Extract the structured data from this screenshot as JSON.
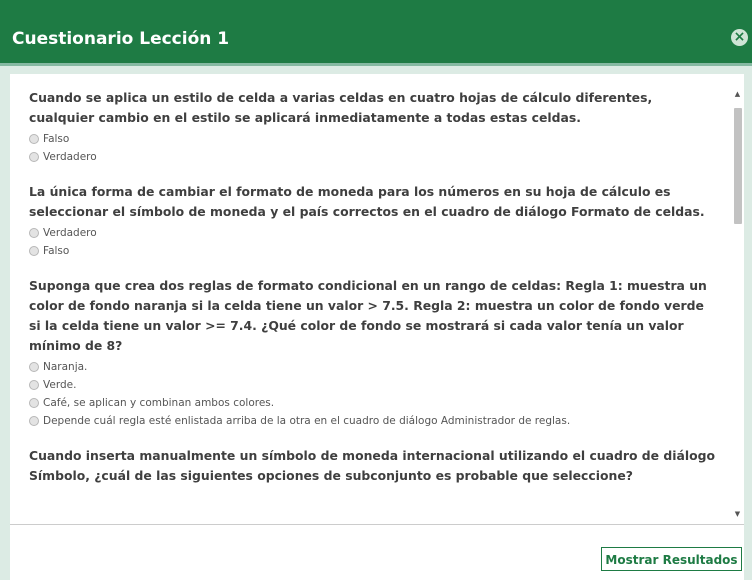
{
  "window": {
    "title": "Cuestionario Lección 1",
    "close_symbol": "×"
  },
  "questions": [
    {
      "text": "Cuando se aplica un estilo de celda a varias celdas en cuatro hojas de cálculo diferentes, cualquier cambio en el estilo se aplicará inmediatamente a todas estas celdas.",
      "options": [
        "Falso",
        "Verdadero"
      ]
    },
    {
      "text": "La única forma de cambiar el formato de moneda para los números en su hoja de cálculo es seleccionar el símbolo de moneda y el país correctos en el cuadro de diálogo Formato de celdas.",
      "options": [
        "Verdadero",
        "Falso"
      ]
    },
    {
      "text": "Suponga que crea dos reglas de formato condicional en un rango de celdas: Regla 1: muestra un color de fondo naranja si la celda tiene un valor > 7.5. Regla 2: muestra un color de fondo verde si la celda tiene un valor >= 7.4. ¿Qué color de fondo se mostrará si cada valor tenía un valor mínimo de 8?",
      "options": [
        "Naranja.",
        "Verde.",
        "Café, se aplican y combinan ambos colores.",
        "Depende cuál regla esté enlistada arriba de la otra en el cuadro de diálogo Administrador de reglas."
      ]
    },
    {
      "text": "Cuando inserta manualmente un símbolo de moneda internacional utilizando el cuadro de diálogo Símbolo, ¿cuál de las siguientes opciones de subconjunto es probable que seleccione?",
      "options": []
    }
  ],
  "scroll": {
    "up_arrow": "▲",
    "down_arrow": "▼"
  },
  "footer": {
    "results_button": "Mostrar Resultados"
  },
  "colors": {
    "header": "#1e7b44",
    "accent_strip": "#85b9a2",
    "frame": "#dcebe4",
    "text": "#3f3f3f"
  },
  "icons": {
    "close": "close-icon",
    "scroll_up": "chevron-up-icon",
    "scroll_down": "chevron-down-icon"
  }
}
